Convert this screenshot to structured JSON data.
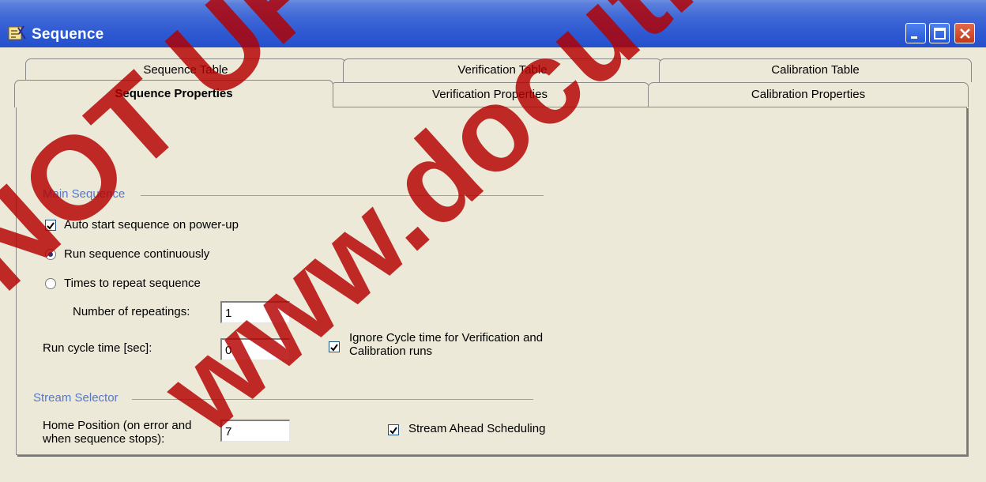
{
  "window": {
    "title": "Sequence"
  },
  "titlebar_icons": {
    "app": "sequence-app-icon",
    "minimize": "minimize-icon",
    "maximize": "maximize-icon",
    "close": "close-icon"
  },
  "tabs": {
    "row1": [
      {
        "label": "Sequence Table"
      },
      {
        "label": "Verification Table"
      },
      {
        "label": "Calibration Table"
      }
    ],
    "row2": [
      {
        "label": "Sequence Properties"
      },
      {
        "label": "Verification Properties"
      },
      {
        "label": "Calibration Properties"
      }
    ],
    "active": "Sequence Properties"
  },
  "main_sequence": {
    "header": "Main Sequence",
    "auto_start": {
      "label": "Auto start sequence on power-up",
      "checked": true
    },
    "run_continuously": {
      "label": "Run sequence continuously",
      "selected": true
    },
    "times_to_repeat": {
      "label": "Times to repeat sequence",
      "selected": false
    },
    "repeatings": {
      "label": "Number of repeatings:",
      "value": "1"
    },
    "cycle_time": {
      "label": "Run cycle time [sec]:",
      "value": "0"
    },
    "ignore_cycle": {
      "label_line1": "Ignore Cycle time for Verification and",
      "label_line2": "Calibration runs",
      "checked": true
    }
  },
  "stream_selector": {
    "header": "Stream Selector",
    "home_position": {
      "label_line1": "Home Position (on error and",
      "label_line2": "when sequence stops):",
      "value": "7"
    },
    "stream_ahead": {
      "label": "Stream Ahead Scheduling",
      "checked": true
    }
  },
  "watermark": {
    "line1": "NOT UP-TO-DATE",
    "line2": "www.docuthek.com"
  }
}
